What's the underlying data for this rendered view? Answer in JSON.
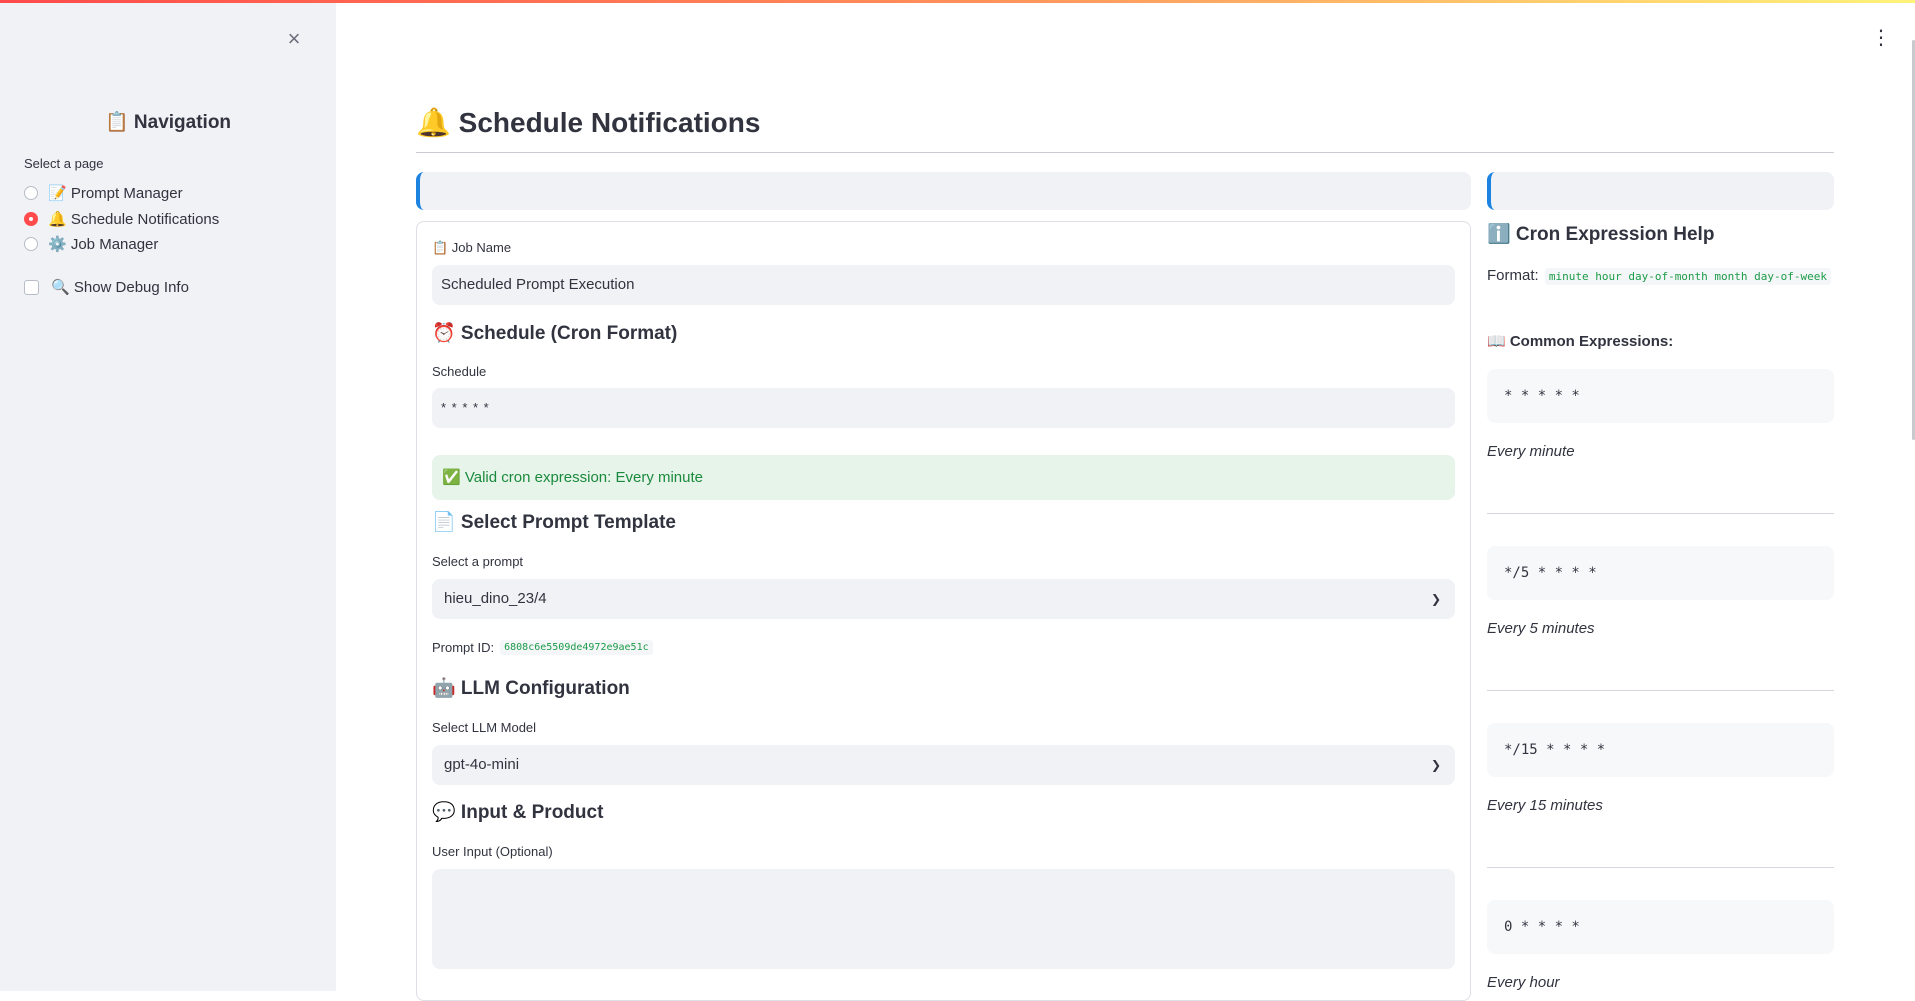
{
  "sidebar": {
    "title": "📋 Navigation",
    "select_label": "Select a page",
    "pages": [
      {
        "label": "📝 Prompt Manager",
        "selected": false
      },
      {
        "label": "🔔 Schedule Notifications",
        "selected": true
      },
      {
        "label": "⚙️ Job Manager",
        "selected": false
      }
    ],
    "debug_label": "🔍 Show Debug Info",
    "close_icon": "×"
  },
  "header": {
    "menu_icon": "⋮"
  },
  "main": {
    "title": "🔔 Schedule Notifications",
    "job_name": {
      "label": "📋 Job Name",
      "value": "Scheduled Prompt Execution"
    },
    "schedule_section": "⏰ Schedule (Cron Format)",
    "schedule": {
      "label": "Schedule",
      "value": "* * * * *"
    },
    "cron_valid_msg": "✅ Valid cron expression: Every minute",
    "prompt_section": "📄 Select Prompt Template",
    "prompt_select": {
      "label": "Select a prompt",
      "value": "hieu_dino_23/4"
    },
    "prompt_id_label": "Prompt ID:",
    "prompt_id_value": "6808c6e5509de4972e9ae51c",
    "llm_section": "🤖 LLM Configuration",
    "llm_select": {
      "label": "Select LLM Model",
      "value": "gpt-4o-mini"
    },
    "input_section": "💬 Input & Product",
    "user_input": {
      "label": "User Input (Optional)",
      "value": ""
    }
  },
  "help": {
    "title": "ℹ️ Cron Expression Help",
    "format_label": "Format:",
    "format_code": "minute hour day-of-month month day-of-week",
    "common_title": "📖 Common Expressions:",
    "expressions": [
      {
        "code": "* * * * *",
        "desc": "Every minute"
      },
      {
        "code": "*/5 * * * *",
        "desc": "Every 5 minutes"
      },
      {
        "code": "*/15 * * * *",
        "desc": "Every 15 minutes"
      },
      {
        "code": "0 * * * *",
        "desc": "Every hour"
      }
    ]
  },
  "colors": {
    "accent": "#ff4b4b",
    "info_border": "#1c83e1",
    "success_text": "#1b8a3e",
    "success_bg": "#e6f4e9",
    "sidebar_bg": "#f0f2f6"
  }
}
